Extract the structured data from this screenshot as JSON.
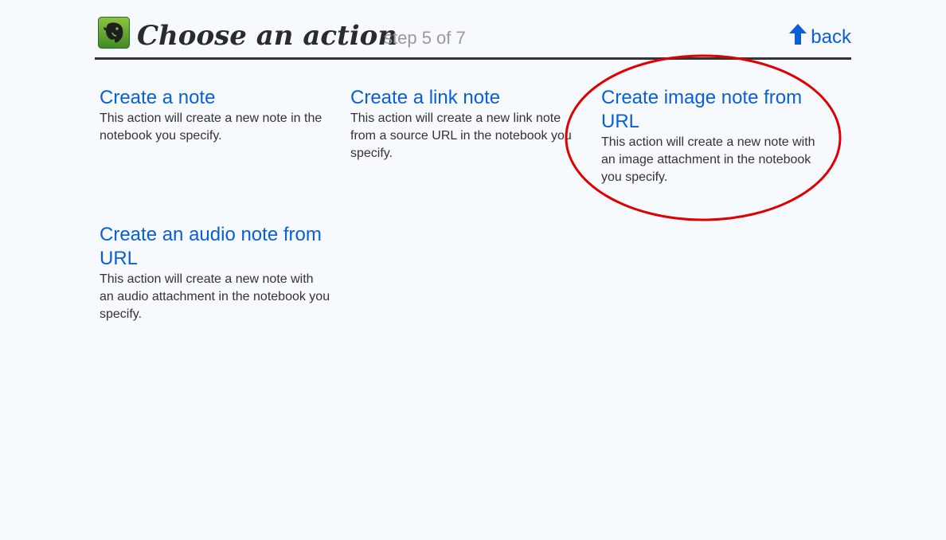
{
  "header": {
    "title": "Choose an action",
    "step": "step 5 of 7",
    "back_label": "back"
  },
  "actions": [
    {
      "title": "Create a note",
      "description": "This action will create a new note in the notebook you specify."
    },
    {
      "title": "Create a link note",
      "description": "This action will create a new link note from a source URL in the notebook you specify."
    },
    {
      "title": "Create image note from URL",
      "description": "This action will create a new note with an image attachment in the notebook you specify."
    },
    {
      "title": "Create an audio note from URL",
      "description": "This action will create a new note with an audio attachment in the notebook you specify."
    }
  ],
  "icons": {
    "logo": "evernote-elephant-icon",
    "back": "arrow-up-icon"
  },
  "colors": {
    "link": "#0a5ed6",
    "step": "#999999",
    "highlight_circle": "#e00000",
    "logo_green": "#5aa637",
    "background": "#f6faff"
  }
}
